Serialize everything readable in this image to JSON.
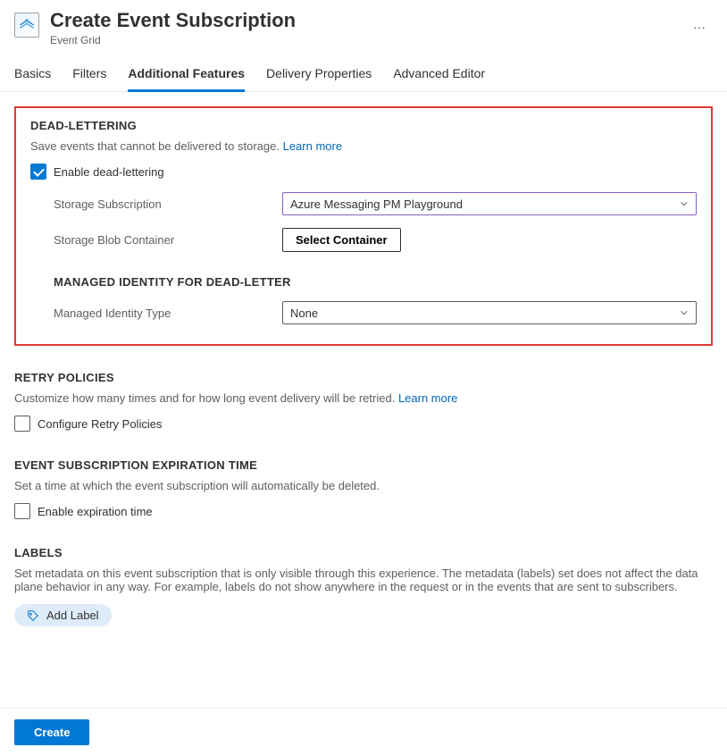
{
  "header": {
    "title": "Create Event Subscription",
    "subtitle": "Event Grid"
  },
  "tabs": {
    "items": [
      "Basics",
      "Filters",
      "Additional Features",
      "Delivery Properties",
      "Advanced Editor"
    ],
    "activeIndex": 2
  },
  "deadLettering": {
    "heading": "DEAD-LETTERING",
    "description": "Save events that cannot be delivered to storage.",
    "learnMore": "Learn more",
    "enableLabel": "Enable dead-lettering",
    "enabled": true,
    "storageSubscriptionLabel": "Storage Subscription",
    "storageSubscriptionValue": "Azure Messaging PM Playground",
    "storageBlobContainerLabel": "Storage Blob Container",
    "selectContainerButton": "Select Container",
    "managedIdentityHeading": "MANAGED IDENTITY FOR DEAD-LETTER",
    "managedIdentityTypeLabel": "Managed Identity Type",
    "managedIdentityTypeValue": "None"
  },
  "retryPolicies": {
    "heading": "RETRY POLICIES",
    "description": "Customize how many times and for how long event delivery will be retried.",
    "learnMore": "Learn more",
    "configureLabel": "Configure Retry Policies",
    "enabled": false
  },
  "expiration": {
    "heading": "EVENT SUBSCRIPTION EXPIRATION TIME",
    "description": "Set a time at which the event subscription will automatically be deleted.",
    "enableLabel": "Enable expiration time",
    "enabled": false
  },
  "labels": {
    "heading": "LABELS",
    "description": "Set metadata on this event subscription that is only visible through this experience. The metadata (labels) set does not affect the data plane behavior in any way. For example, labels do not show anywhere in the request or in the events that are sent to subscribers.",
    "addLabelButton": "Add Label"
  },
  "footer": {
    "createButton": "Create"
  }
}
